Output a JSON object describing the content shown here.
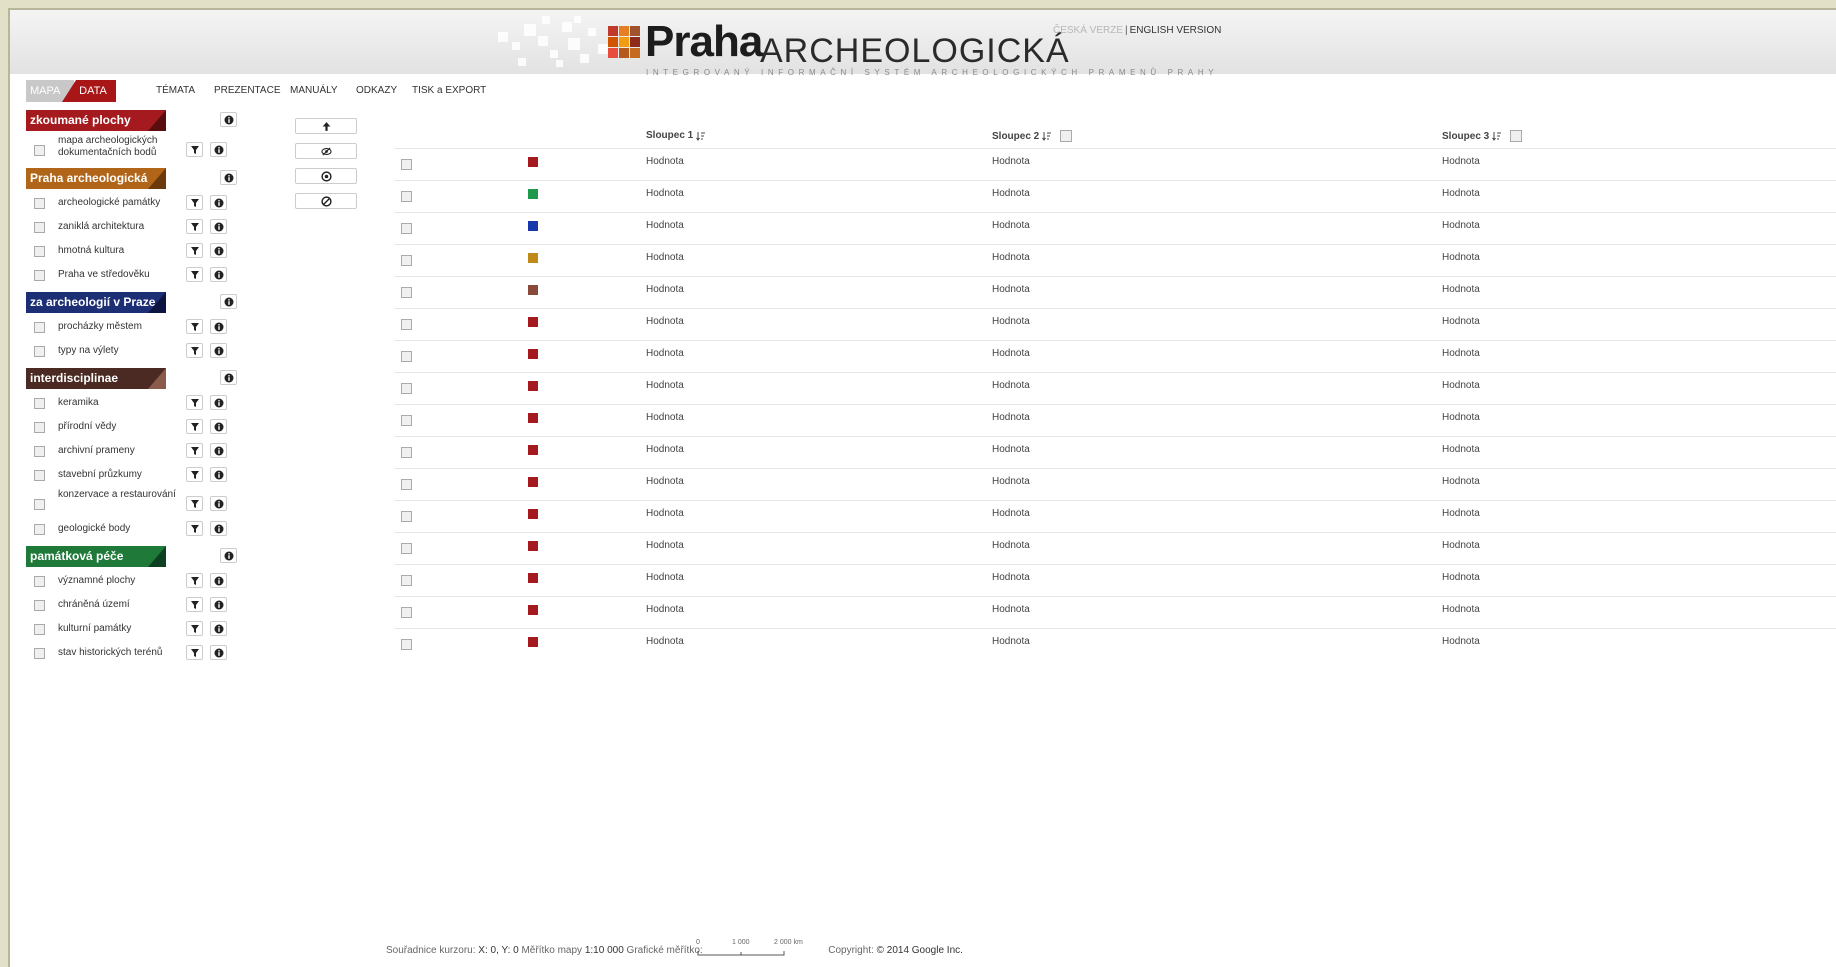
{
  "brand": {
    "name": "Praha",
    "name_suffix": "ARCHEOLOGICKÁ",
    "subtitle": "INTEGROVANÝ INFORMAČNÍ SYSTÉM ARCHEOLOGICKÝCH PRAMENŮ PRAHY",
    "logo_colors": [
      "#c0392b",
      "#e67e22",
      "#a0522d",
      "#d35400",
      "#f39c12",
      "#8e2b1c",
      "#e74c3c",
      "#b35a1f",
      "#c66a20"
    ]
  },
  "language": {
    "czech": "ČESKÁ VERZE",
    "separator": "|",
    "english": "ENGLISH VERSION"
  },
  "view_toggle": {
    "map": "MAPA",
    "data": "DATA"
  },
  "menu": [
    "TÉMATA",
    "PREZENTACE",
    "MANUÁLY",
    "ODKAZY",
    "TISK a EXPORT"
  ],
  "layer_groups": [
    {
      "title": "zkoumané plochy",
      "color": "#a51a1e",
      "accent": "#5a0d0f",
      "items": [
        "mapa archeologických dokumentačních bodů"
      ]
    },
    {
      "title": "Praha archeologická",
      "color": "#b06518",
      "accent": "#6a3a0a",
      "items": [
        "archeologické památky",
        "zaniklá architektura",
        "hmotná kultura",
        "Praha ve středověku"
      ]
    },
    {
      "title": "za archeologií v Praze",
      "color": "#1c2e74",
      "accent": "#0b1540",
      "items": [
        "procházky městem",
        "typy na výlety"
      ]
    },
    {
      "title": "interdisciplinae",
      "color": "#4a2a22",
      "accent": "#8a5a4a",
      "items": [
        "keramika",
        "přírodní vědy",
        "archivní prameny",
        "stavební průzkumy",
        "konzervace a restaurování",
        "geologické body"
      ]
    },
    {
      "title": "památková péče",
      "color": "#1f7a3a",
      "accent": "#0d4020",
      "items": [
        "významné plochy",
        "chráněná území",
        "kulturní památky",
        "stav historických terénů"
      ]
    }
  ],
  "tools": [
    "arrow-up-icon",
    "eye-slash-icon",
    "target-icon",
    "cancel-icon"
  ],
  "table": {
    "columns": [
      "Sloupec 1",
      "Sloupec 2",
      "Sloupec 3"
    ],
    "rows": [
      {
        "color": "#a51a1e",
        "values": [
          "Hodnota",
          "Hodnota",
          "Hodnota"
        ]
      },
      {
        "color": "#1f9a4a",
        "values": [
          "Hodnota",
          "Hodnota",
          "Hodnota"
        ]
      },
      {
        "color": "#1638a8",
        "values": [
          "Hodnota",
          "Hodnota",
          "Hodnota"
        ]
      },
      {
        "color": "#c08a1a",
        "values": [
          "Hodnota",
          "Hodnota",
          "Hodnota"
        ]
      },
      {
        "color": "#8a4a3a",
        "values": [
          "Hodnota",
          "Hodnota",
          "Hodnota"
        ]
      },
      {
        "color": "#a51a1e",
        "values": [
          "Hodnota",
          "Hodnota",
          "Hodnota"
        ]
      },
      {
        "color": "#a51a1e",
        "values": [
          "Hodnota",
          "Hodnota",
          "Hodnota"
        ]
      },
      {
        "color": "#a51a1e",
        "values": [
          "Hodnota",
          "Hodnota",
          "Hodnota"
        ]
      },
      {
        "color": "#a51a1e",
        "values": [
          "Hodnota",
          "Hodnota",
          "Hodnota"
        ]
      },
      {
        "color": "#a51a1e",
        "values": [
          "Hodnota",
          "Hodnota",
          "Hodnota"
        ]
      },
      {
        "color": "#a51a1e",
        "values": [
          "Hodnota",
          "Hodnota",
          "Hodnota"
        ]
      },
      {
        "color": "#a51a1e",
        "values": [
          "Hodnota",
          "Hodnota",
          "Hodnota"
        ]
      },
      {
        "color": "#a51a1e",
        "values": [
          "Hodnota",
          "Hodnota",
          "Hodnota"
        ]
      },
      {
        "color": "#a51a1e",
        "values": [
          "Hodnota",
          "Hodnota",
          "Hodnota"
        ]
      },
      {
        "color": "#a51a1e",
        "values": [
          "Hodnota",
          "Hodnota",
          "Hodnota"
        ]
      },
      {
        "color": "#a51a1e",
        "values": [
          "Hodnota",
          "Hodnota",
          "Hodnota"
        ]
      }
    ]
  },
  "footer": {
    "coords_label": "Souřadnice kurzoru:",
    "coords_value": "X: 0, Y: 0",
    "scale_label": "Měřítko mapy",
    "scale_value": "1:10 000",
    "graphic_scale_label": "Grafické měřítko:",
    "scale_ticks": [
      "0",
      "1 000",
      "2 000 km"
    ],
    "copyright_label": "Copyright:",
    "copyright_value": "© 2014 Google Inc."
  }
}
